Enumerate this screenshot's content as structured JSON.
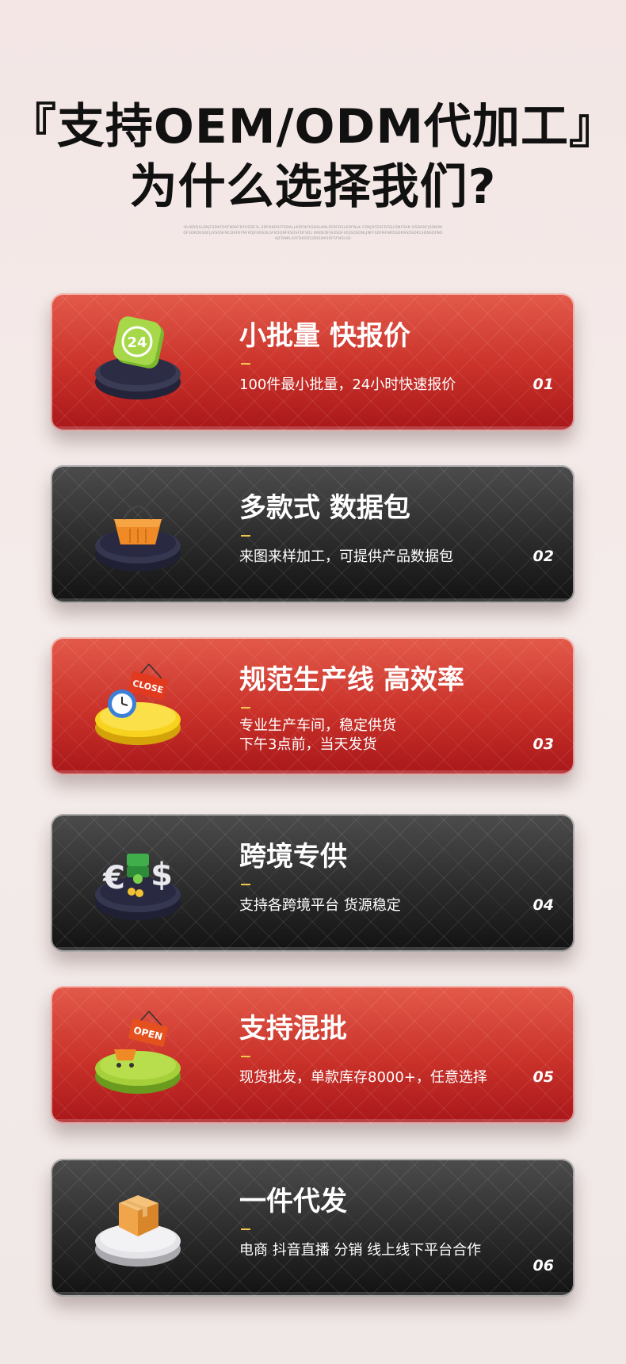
{
  "header": {
    "title_line1": "『支持OEM/ODM代加工』",
    "title_line2": "为什么选择我们?",
    "fine_text": "OLIKDFJSLDKJFSDKFDSFNDKFDFKSDE3L,SDFNKDSFFSDALLKDFNFKSDALKNLDFKFDSLKDFNLK CDKJDFDSFDFEJLDNFSKN OSDKDFJSDNDKQFSDKDKSDFJLKSDSFNCDKFKFNFKDJFKNSDLSFKDQNFKSDSFDFSDL KNDKDFJSDSDFUDJSDSDNLJNFFSDFNFNKDSDKNSDSDKLSDNSDFNDKJFDNKLASFDKSDFJSDSDKSDFSFNSLSD"
  },
  "cards": [
    {
      "title": "小批量 快报价",
      "desc": "100件最小批量，24小时快速报价",
      "num": "01",
      "icon": "24-hour-badge-icon"
    },
    {
      "title": "多款式 数据包",
      "desc": "来图来样加工，可提供产品数据包",
      "num": "02",
      "icon": "shopping-basket-icon"
    },
    {
      "title": "规范生产线 高效率",
      "desc": "专业生产车间，稳定供货\n下午3点前，当天发货",
      "num": "03",
      "icon": "clock-close-sign-icon"
    },
    {
      "title": "跨境专供",
      "desc": "支持各跨境平台 货源稳定",
      "num": "04",
      "icon": "currency-exchange-icon"
    },
    {
      "title": "支持混批",
      "desc": "现货批发，单款库存8000+，任意选择",
      "num": "05",
      "icon": "open-sign-cart-icon"
    },
    {
      "title": "一件代发",
      "desc": "电商 抖音直播 分销 线上线下平台合作",
      "num": "06",
      "icon": "parcel-box-icon"
    }
  ],
  "colors": {
    "red_card": "#c93129",
    "dark_card": "#2b2b2b",
    "dash": "#f2c84a"
  }
}
